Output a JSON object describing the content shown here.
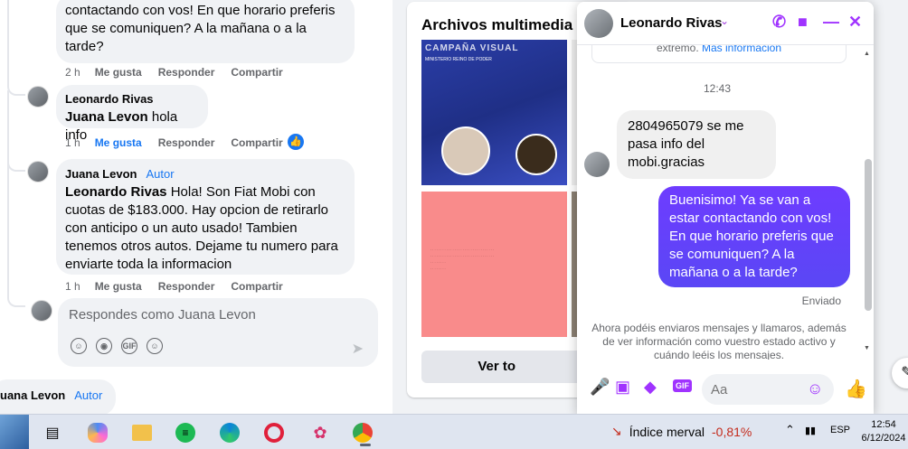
{
  "comments": {
    "top_partial": {
      "text": "contactando con vos! En que horario preferis que se comuniquen? A la mañana o a la tarde?",
      "time": "2 h",
      "like": "Me gusta",
      "reply": "Responder",
      "share": "Compartir"
    },
    "c1": {
      "author": "Leonardo Rivas",
      "mention": "Juana Levon",
      "text": " hola info",
      "time": "1 h",
      "like": "Me gusta",
      "reply": "Responder",
      "share": "Compartir"
    },
    "c2": {
      "author": "Juana Levon",
      "badge": "Autor",
      "mention": "Leonardo Rivas",
      "text": " Hola! Son Fiat Mobi con cuotas de $183.000. Hay opcion de retirarlo con anticipo o un auto usado! Tambien tenemos otros autos. Dejame tu numero para enviarte toda la informacion",
      "time": "1 h",
      "like": "Me gusta",
      "reply": "Responder",
      "share": "Compartir"
    },
    "reply_placeholder": "Respondes como Juana Levon",
    "bottom_author": "uana Levon",
    "bottom_badge": "Autor"
  },
  "media": {
    "title": "Archivos multimedia re",
    "thumb1_title": "CAMPAÑA VISUAL",
    "thumb1_sub": "MINISTERIO REINO DE PODER",
    "button": "Ver to"
  },
  "chat": {
    "name": "Leonardo Rivas",
    "sys_note": "extremo.",
    "sys_link": "Más información",
    "time": "12:43",
    "incoming": "2804965079 se me pasa info del mobi.gracias",
    "outgoing": "Buenisimo! Ya se van a estar contactando con vos! En que horario preferis que se comuniquen? A la mañana o a la tarde?",
    "sent_label": "Enviado",
    "bottom_note": "Ahora podéis enviaros mensajes y llamaros, además de ver información como vuestro estado activo y cuándo leéis los mensajes.",
    "input_placeholder": "Aa",
    "gif": "GIF"
  },
  "taskbar": {
    "merval_label": "Índice merval",
    "merval_value": "-0,81%",
    "lang": "ESP",
    "time": "12:54",
    "date": "6/12/2024"
  },
  "colors": {
    "messenger_accent": "#a033ff",
    "facebook_blue": "#1877f2"
  }
}
